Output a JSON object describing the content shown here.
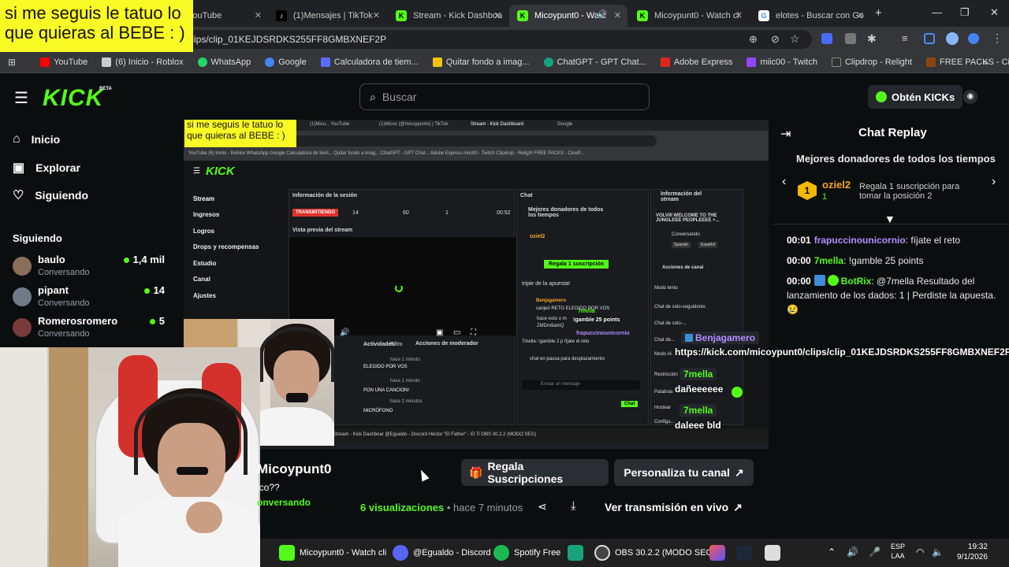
{
  "overlay_note": "si me seguis le tatuo lo que quieras al BEBE : )",
  "tabs": [
    {
      "label": "YouTube",
      "color": "#ff0000"
    },
    {
      "label": "(1)Mensajes | TikTok",
      "color": "#000000"
    },
    {
      "label": "Stream - Kick Dashboa",
      "color": "#53fc18"
    },
    {
      "label": "Micoypunt0 - Watc",
      "color": "#53fc18"
    },
    {
      "label": "Micoypunt0 - Watch cl",
      "color": "#53fc18"
    },
    {
      "label": "elotes - Buscar con Go",
      "color": "#4285f4"
    }
  ],
  "url": "/clips/clip_01KEJDSRDKS255FF8GMBXNEF2P",
  "bookmarks": [
    {
      "label": "YouTube",
      "color": "#ff0000"
    },
    {
      "label": "(6) Inicio - Roblox",
      "color": "#cccccc"
    },
    {
      "label": "WhatsApp",
      "color": "#25d366"
    },
    {
      "label": "Google",
      "color": "#4285f4"
    },
    {
      "label": "Calculadora de tiem...",
      "color": "#5a6cff"
    },
    {
      "label": "Quitar fondo a imag...",
      "color": "#f1c40f"
    },
    {
      "label": "ChatGPT - GPT Chat...",
      "color": "#10a37f"
    },
    {
      "label": "Adobe Express",
      "color": "#e1251b"
    },
    {
      "label": "miic00 - Twitch",
      "color": "#9146ff"
    },
    {
      "label": "Clipdrop - Relight",
      "color": "#333333"
    },
    {
      "label": "FREE PACKS - CineP...",
      "color": "#8b4513"
    }
  ],
  "header": {
    "logo": "KICK",
    "beta": "BETA",
    "search_placeholder": "Buscar",
    "kicks_button": "Obtén KICKs"
  },
  "sidebar": {
    "nav": [
      {
        "label": "Inicio",
        "icon": "home-icon"
      },
      {
        "label": "Explorar",
        "icon": "compass-icon"
      },
      {
        "label": "Siguiendo",
        "icon": "heart-icon"
      }
    ],
    "following_title": "Siguiendo",
    "channels": [
      {
        "name": "baulo",
        "status": "Conversando",
        "viewers": "1,4 mil",
        "color": "#8a6d5a"
      },
      {
        "name": "pipant",
        "status": "Conversando",
        "viewers": "14",
        "color": "#6f7b8a"
      },
      {
        "name": "Romerosromero",
        "status": "Conversando",
        "viewers": "5",
        "color": "#7a3b3b"
      }
    ]
  },
  "inner_stream": {
    "note": "si me seguis le tatuo lo que quieras al BEBE : )",
    "mini_tabs": [
      "(1)Mico... YouTube",
      "(1)Micos (@micoypunto) | TikTok",
      "Stream - Kick Dashboard",
      "Google"
    ],
    "mini_bookmarks": "YouTube   (6) Inicio - Roblox   WhatsApp   Google   Calculadora de tiem...   Quitar fondo a imag...   ChatGPT - GPT Chat...   Adobe Express   miic00 - Twitch   Clipdrop - Relight   FREE PACKS - CineP...",
    "nav": [
      "Stream",
      "Ingresos",
      "Logros",
      "Drops y recompensas",
      "Estudio",
      "Canal",
      "Ajustes"
    ],
    "session_title": "Información de la sesión",
    "live_label": "TRANSMITIENDO",
    "session_stats": [
      "14",
      "60",
      "1",
      "00:52"
    ],
    "preview_title": "Vista previa del stream",
    "chat_title": "Chat",
    "donors_title": "Mejores donadores de todos los tiempos",
    "donor_name": "oziel2",
    "gift_button": "Regala 1 suscripción",
    "chat_lines": [
      "tripie de la apuesta!",
      "Benjagamero",
      "canjeó RETO ELEGIDO POR VOS",
      "7mella: !gamble 2 p fíjate el reto"
    ],
    "paused_label": "chat en pausa para desplazamiento",
    "send_placeholder": "Enviar un mensaje",
    "send_button": "Chat",
    "stream_info_title": "Información del stream",
    "stream_info_text": "VOLVIII WELCOME TO THE JUNGLEEE PEOPLEEEE +...",
    "stream_category": "Conversando",
    "stream_tags": [
      "Spanish",
      "Español"
    ],
    "channel_actions_title": "Acciones de canal",
    "channel_actions": [
      "Modo lento",
      "Chat de solo-seguidores",
      "Chat de solo-...",
      "Chat de...",
      "Modo IA",
      "Restricción",
      "Palabras",
      "Hostear",
      "Configu..."
    ],
    "activity_title": "Actividades",
    "filter": "Filtro",
    "mod_actions_title": "Acciones de moderador",
    "activity_items": [
      "hace 1 minuto",
      "hace 1 minuto",
      "hace 2 minutos"
    ],
    "activity_texts": [
      "ELEGIDO POR VOS",
      "PON UNA CANCION!",
      "MICRÓFONO"
    ],
    "mini_taskbar": "Stream - Kick Dashboar     @Egualdo - Discord     Héctor \"El Father\" - El Ti     OBS 30.2.2 (MODO SEG)"
  },
  "chat": {
    "title": "Chat Replay",
    "donors_title": "Mejores donadores de todos los tiempos",
    "donor": {
      "rank": "1",
      "name": "oziel2",
      "amount": "1"
    },
    "gift_text": "Regala 1 suscripción para tomar la posición 2",
    "messages": [
      {
        "time": "00:01",
        "user": "frapuccinounicornio",
        "color": "#b28cff",
        "text": ": fíjate el reto"
      },
      {
        "time": "00:00",
        "user": "7mella",
        "color": "#53fc18",
        "text": ": !gamble 25 points"
      },
      {
        "time": "00:00",
        "user": "BotRix",
        "color": "#53fc18",
        "text": ": @7mella Resultado del lanzamiento de los dados: 1 | Perdiste la apuesta. 😢"
      }
    ]
  },
  "overlays": {
    "highlight_user": "Benjagamero",
    "clip_url": "https://kick.com/micoypunt0/clips/clip_01KEJDSRDKS255FF8GMBXNEF2P",
    "user1": "7mella",
    "text1": "dañeeeeee",
    "user2": "7mella",
    "text2": "daleee bld",
    "mini_user1": "7mella",
    "mini_text1": "!gamble 25 points",
    "mini_user2": "frapuccinounicornio",
    "mini_text2": "hace esto o m",
    "mini_text3": "ZMDm9amQ"
  },
  "webcam": {
    "channel_name": "Micoypunt0",
    "subtitle": "ico??",
    "category": "onversando"
  },
  "below_video": {
    "gift_subs": "Regala Suscripciones",
    "customize": "Personaliza tu canal",
    "views_count": "6",
    "views_label": "visualizaciones",
    "time_ago": "• hace 7 minutos",
    "watch_live": "Ver transmisión en vivo"
  },
  "taskbar": {
    "items": [
      {
        "label": "Micoypunt0 - Watch cli",
        "color": "#53fc18"
      },
      {
        "label": "@Egualdo - Discord",
        "color": "#5865f2"
      },
      {
        "label": "Spotify Free",
        "color": "#1db954"
      },
      {
        "label": "",
        "color": "#1aa37a"
      },
      {
        "label": "OBS 30.2.2 (MODO SEG",
        "color": "#444444"
      }
    ],
    "lang": "ESP",
    "lang2": "LAA",
    "time": "19:32",
    "date": "9/1/2026"
  }
}
